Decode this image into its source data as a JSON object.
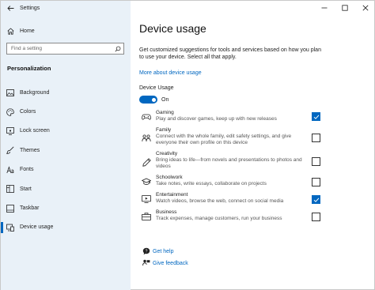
{
  "window": {
    "title": "Settings"
  },
  "sidebar": {
    "home_label": "Home",
    "search_placeholder": "Find a setting",
    "section_title": "Personalization",
    "items": [
      {
        "label": "Background",
        "icon": "picture-icon"
      },
      {
        "label": "Colors",
        "icon": "palette-icon"
      },
      {
        "label": "Lock screen",
        "icon": "lock-screen-icon"
      },
      {
        "label": "Themes",
        "icon": "brush-icon"
      },
      {
        "label": "Fonts",
        "icon": "font-icon"
      },
      {
        "label": "Start",
        "icon": "start-icon"
      },
      {
        "label": "Taskbar",
        "icon": "taskbar-icon"
      },
      {
        "label": "Device usage",
        "icon": "device-usage-icon",
        "active": true
      }
    ]
  },
  "main": {
    "title": "Device usage",
    "description": "Get customized suggestions for tools and services based on how you plan to use your device. Select all that apply.",
    "more_link": "More about device usage",
    "toggle_label": "Device Usage",
    "toggle_state": "On",
    "options": [
      {
        "title": "Gaming",
        "desc": "Play and discover games, keep up with new releases",
        "checked": true,
        "icon": "gamepad-icon"
      },
      {
        "title": "Family",
        "desc": "Connect with the whole family, edit safety settings, and give everyone their own profile on this device",
        "checked": false,
        "icon": "family-icon"
      },
      {
        "title": "Creativity",
        "desc": "Bring ideas to life—from novels and presentations to photos and videos",
        "checked": false,
        "icon": "pen-icon"
      },
      {
        "title": "Schoolwork",
        "desc": "Take notes, write essays, collaborate on projects",
        "checked": false,
        "icon": "graduation-cap-icon"
      },
      {
        "title": "Entertainment",
        "desc": "Watch videos, browse the web, connect on social media",
        "checked": true,
        "icon": "entertainment-icon"
      },
      {
        "title": "Business",
        "desc": "Track expenses, manage customers, run your business",
        "checked": false,
        "icon": "briefcase-icon"
      }
    ],
    "get_help": "Get help",
    "give_feedback": "Give feedback"
  },
  "colors": {
    "accent": "#0067c0",
    "sidebar_bg": "#e9f1f8"
  }
}
